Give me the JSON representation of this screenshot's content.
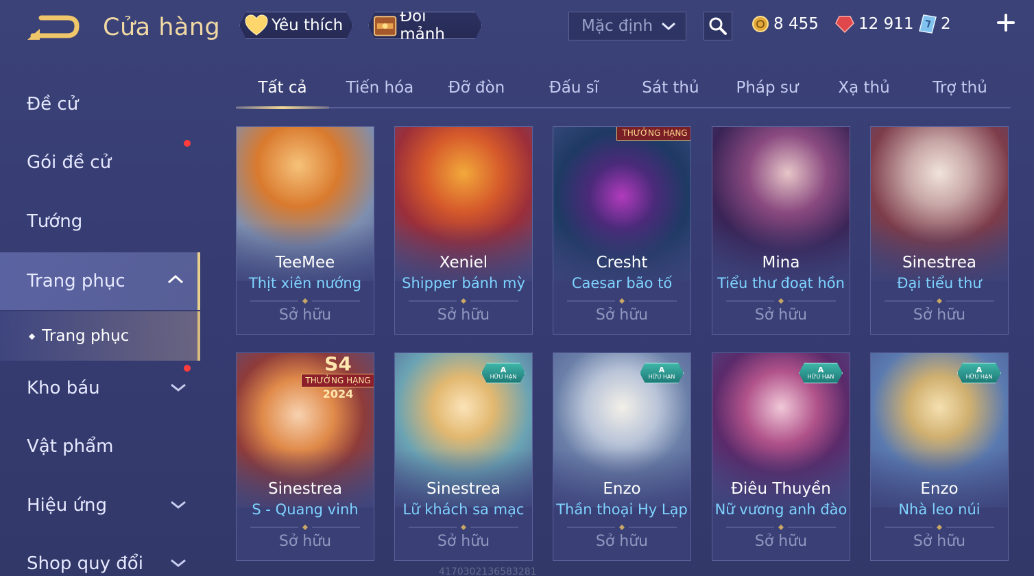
{
  "header": {
    "title": "Cửa hàng",
    "favorite_label": "Yêu thích",
    "exchange_label": "Đổi mảnh",
    "sort_value": "Mặc định",
    "currencies": {
      "gold": "8 455",
      "voucher": "12 911",
      "ticket": "2"
    }
  },
  "sidebar": {
    "items": [
      {
        "label": "Đề cử"
      },
      {
        "label": "Gói đề cử"
      },
      {
        "label": "Tướng"
      },
      {
        "label": "Trang phục"
      },
      {
        "label": "Kho báu"
      },
      {
        "label": "Vật phẩm"
      },
      {
        "label": "Hiệu ứng"
      },
      {
        "label": "Shop quy đổi"
      }
    ],
    "sub_item": "Trang phục"
  },
  "tabs": [
    "Tất cả",
    "Tiến hóa",
    "Đỡ đòn",
    "Đấu sĩ",
    "Sát thủ",
    "Pháp sư",
    "Xạ thủ",
    "Trợ thủ"
  ],
  "cards": [
    {
      "hero": "TeeMee",
      "skin": "Thịt xiên nướng",
      "status": "Sở hữu"
    },
    {
      "hero": "Xeniel",
      "skin": "Shipper bánh mỳ",
      "status": "Sở hữu"
    },
    {
      "hero": "Cresht",
      "skin": "Caesar bão tố",
      "status": "Sở hữu",
      "banner": "THƯỞNG HẠNG"
    },
    {
      "hero": "Mina",
      "skin": "Tiểu thư đoạt hồn",
      "status": "Sở hữu"
    },
    {
      "hero": "Sinestrea",
      "skin": "Đại tiểu thư",
      "status": "Sở hữu"
    },
    {
      "hero": "Sinestrea",
      "skin": "S - Quang vinh",
      "status": "Sở hữu",
      "s4": {
        "top": "S4",
        "mid": "THƯỞNG HẠNG",
        "year": "2024"
      }
    },
    {
      "hero": "Sinestrea",
      "skin": "Lữ khách sa mạc",
      "status": "Sở hữu",
      "badge": {
        "grade": "A",
        "text": "HỮU HẠN"
      }
    },
    {
      "hero": "Enzo",
      "skin": "Thần thoại Hy Lạp",
      "status": "Sở hữu",
      "badge": {
        "grade": "A",
        "text": "HỮU HẠN"
      }
    },
    {
      "hero": "Điêu Thuyền",
      "skin": "Nữ vương anh đào",
      "status": "Sở hữu",
      "badge": {
        "grade": "A",
        "text": "HỮU HẠN"
      }
    },
    {
      "hero": "Enzo",
      "skin": "Nhà leo núi",
      "status": "Sở hữu",
      "badge": {
        "grade": "A",
        "text": "HỮU HẠN"
      }
    }
  ],
  "watermark": "4170302136583281",
  "colors": {
    "accent_gold": "#f1d9a4",
    "skin_name": "#7fd3ff",
    "status": "#9097bf",
    "notify": "#ff3b3b"
  }
}
